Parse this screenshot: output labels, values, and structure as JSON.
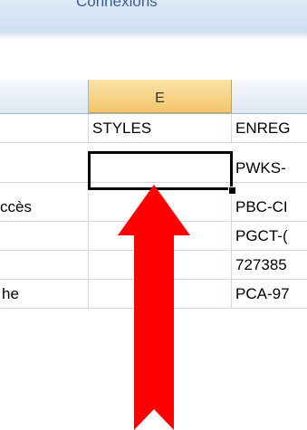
{
  "ribbon": {
    "label": "Connexions"
  },
  "columns": [
    {
      "id": "D",
      "label": ""
    },
    {
      "id": "E",
      "label": "E",
      "selected": true
    },
    {
      "id": "F",
      "label": ""
    }
  ],
  "rows": [
    {
      "d": "",
      "e": "STYLES",
      "f": "ENREG"
    },
    {
      "d": "",
      "e": "",
      "f": "PWKS-"
    },
    {
      "d": "ccès",
      "e": "",
      "f": "PBC-CI"
    },
    {
      "d": "",
      "e": "",
      "f": "PGCT-("
    },
    {
      "d": "",
      "e": "",
      "f": "727385"
    },
    {
      "d": "he",
      "e": "",
      "f": "PCA-97"
    }
  ],
  "colors": {
    "arrow": "#ff0000",
    "selected_header": "#f3c56c",
    "ribbon_text": "#3b5e96"
  },
  "icons": {
    "arrow": "red-up-arrow"
  }
}
